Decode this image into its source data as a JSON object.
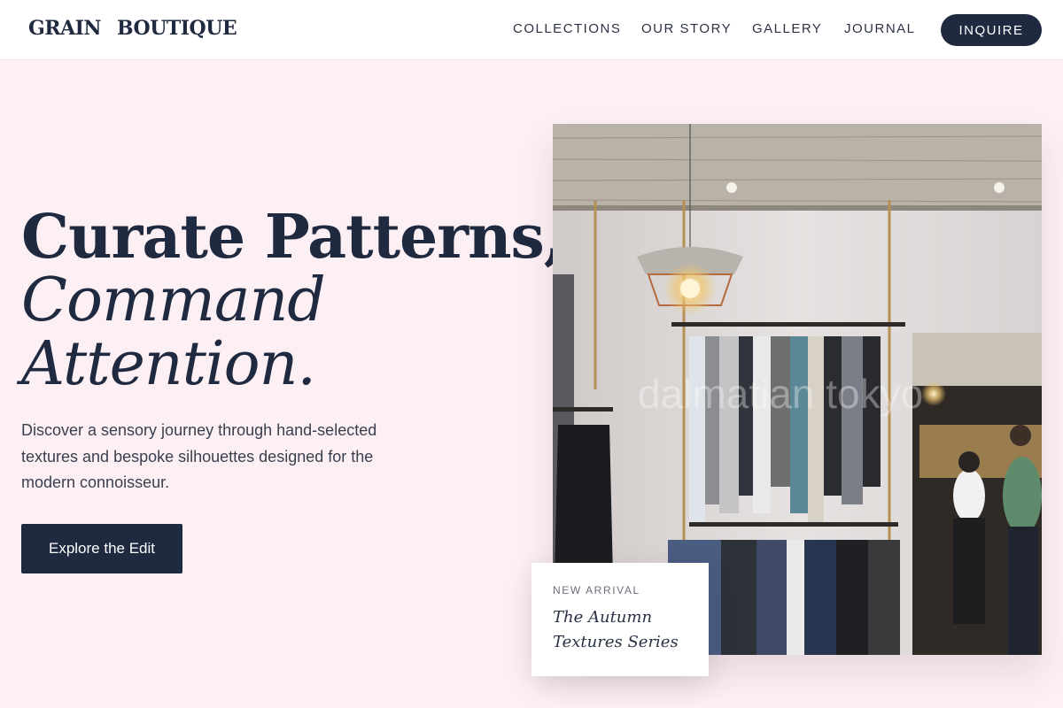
{
  "brand": {
    "word1": "GRAIN",
    "word2": "BOUTIQUE"
  },
  "nav": {
    "items": [
      "COLLECTIONS",
      "OUR STORY",
      "GALLERY",
      "JOURNAL"
    ],
    "cta": "INQUIRE"
  },
  "hero": {
    "line1": "Curate Patterns,",
    "line2": "Command",
    "line3": "Attention.",
    "description": "Discover a sensory journey through hand-selected textures and bespoke silhouettes designed for the modern connoisseur.",
    "cta": "Explore the Edit"
  },
  "image": {
    "watermark": "dalmatian tokyo"
  },
  "card": {
    "kicker": "NEW ARRIVAL",
    "title_line1": "The Autumn",
    "title_line2": "Textures Series"
  },
  "colors": {
    "background": "#fdf0f4",
    "navy": "#1f2a40",
    "header": "#ffffff"
  }
}
